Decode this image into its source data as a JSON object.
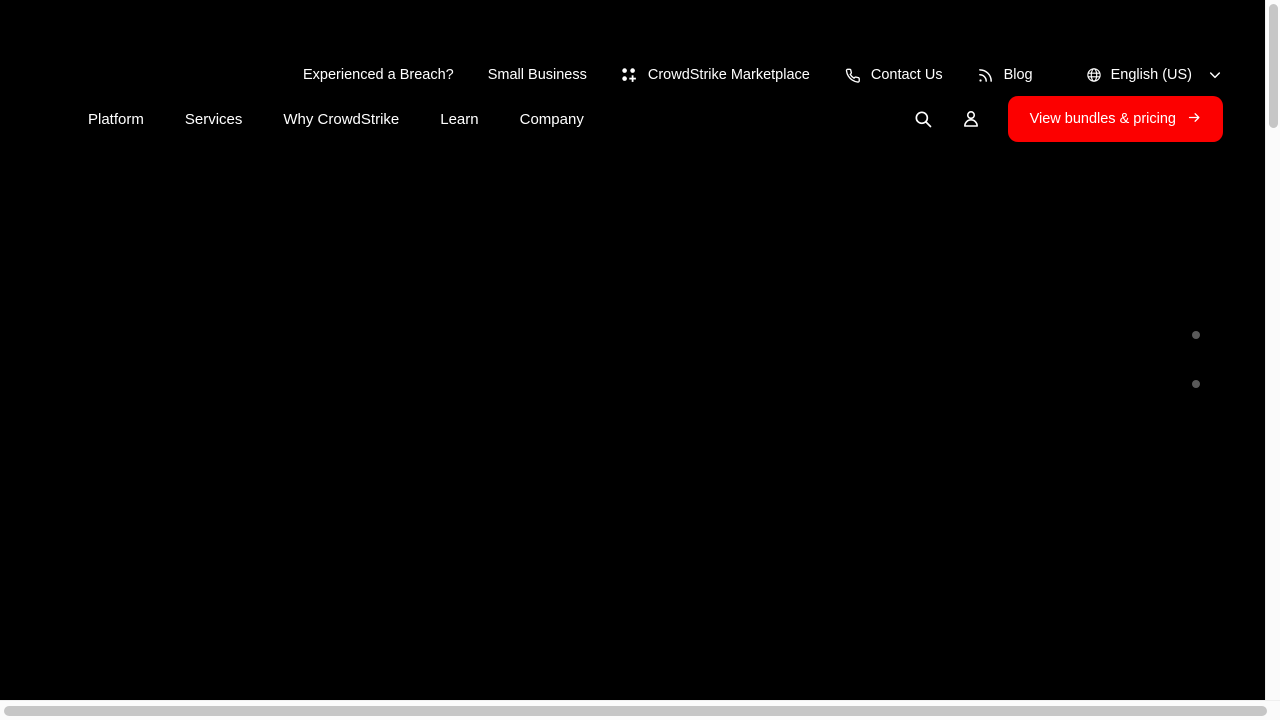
{
  "site": {
    "background_color": "#000000",
    "accent_color": "#fc0000",
    "text_color": "#ffffff"
  },
  "utility_nav": {
    "items": [
      {
        "label": "Experienced a Breach?",
        "icon": ""
      },
      {
        "label": "Small Business",
        "icon": ""
      },
      {
        "label": "CrowdStrike Marketplace",
        "icon": "marketplace-grid-icon"
      },
      {
        "label": "Contact Us",
        "icon": "phone-icon"
      },
      {
        "label": "Blog",
        "icon": "rss-icon"
      }
    ],
    "language": {
      "label": "English (US)",
      "icon": "globe-icon",
      "chevron": "chevron-down-icon"
    }
  },
  "main_nav": {
    "items": [
      {
        "label": "Platform"
      },
      {
        "label": "Services"
      },
      {
        "label": "Why CrowdStrike"
      },
      {
        "label": "Learn"
      },
      {
        "label": "Company"
      }
    ],
    "search_icon": "search-icon",
    "account_icon": "user-account-icon",
    "cta": {
      "label": "View bundles & pricing",
      "arrow": "arrow-right-icon",
      "color": "#fc0000"
    }
  },
  "carousel": {
    "dots": [
      {
        "index": 1,
        "active": false
      },
      {
        "index": 2,
        "active": false
      }
    ],
    "dot_color": "#595959"
  },
  "scrollbars": {
    "vertical": {
      "thumb_color": "#c6c6c6",
      "track_color": "#fbfbfb"
    },
    "horizontal": {
      "thumb_color": "#c6c6c6",
      "track_color": "#fbfbfb"
    }
  }
}
